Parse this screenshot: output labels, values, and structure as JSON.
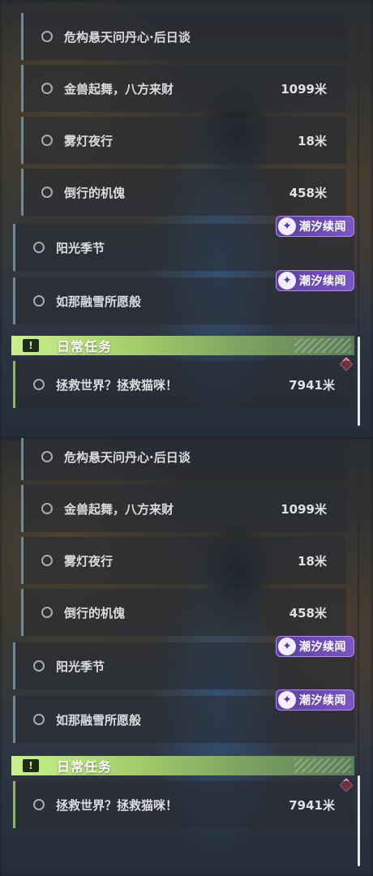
{
  "panels": [
    {
      "quests": [
        {
          "label": "危构悬天问丹心·后日谈",
          "distance": ""
        },
        {
          "label": "金兽起舞，八方来财",
          "distance": "1099米"
        },
        {
          "label": "雾灯夜行",
          "distance": "18米"
        },
        {
          "label": "倒行的机傀",
          "distance": "458米"
        },
        {
          "label": "阳光季节",
          "distance": ""
        },
        {
          "label": "如那融雪所愿般",
          "distance": ""
        }
      ],
      "badges": [
        "潮汐续闻",
        "潮汐续闻"
      ],
      "daily": {
        "title": "日常任务",
        "icon": "alert-icon",
        "quest": {
          "label": "拯救世界？拯救猫咪！",
          "distance": "7941米"
        }
      }
    },
    {
      "quests": [
        {
          "label": "危构悬天问丹心·后日谈",
          "distance": ""
        },
        {
          "label": "金兽起舞，八方来财",
          "distance": "1099米"
        },
        {
          "label": "雾灯夜行",
          "distance": "18米"
        },
        {
          "label": "倒行的机傀",
          "distance": "458米"
        },
        {
          "label": "阳光季节",
          "distance": ""
        },
        {
          "label": "如那融雪所愿般",
          "distance": ""
        }
      ],
      "badges": [
        "潮汐续闻",
        "潮汐续闻"
      ],
      "daily": {
        "title": "日常任务",
        "icon": "alert-icon",
        "quest": {
          "label": "拯救世界？拯救猫咪！",
          "distance": "7941米"
        }
      }
    }
  ],
  "colors": {
    "badge": "#6b4bb8",
    "daily_accent": "#a4cf6a",
    "row_accent": "#6f8a94",
    "marker": "#d94050"
  }
}
